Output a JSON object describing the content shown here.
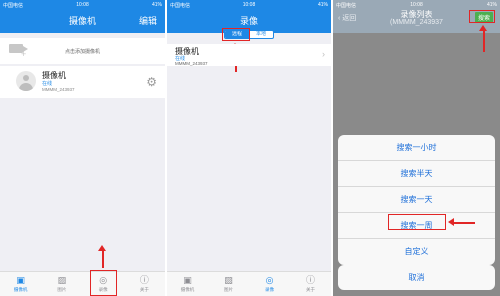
{
  "status": {
    "carrier": "中国电信",
    "time": "10:08",
    "battery": "41%"
  },
  "screen1": {
    "title": "摄像机",
    "edit_label": "编辑",
    "add_camera_text": "点击添加摄像机",
    "camera": {
      "name": "摄像机",
      "status": "在线",
      "id": "MMMM_243937"
    },
    "tabs": [
      {
        "label": "摄像机",
        "icon": "camera-tab-icon"
      },
      {
        "label": "图片",
        "icon": "picture-tab-icon"
      },
      {
        "label": "录像",
        "icon": "record-tab-icon"
      },
      {
        "label": "关于",
        "icon": "info-tab-icon"
      }
    ]
  },
  "screen2": {
    "title": "录像",
    "segments": [
      "远程",
      "本地"
    ],
    "camera": {
      "name": "摄像机",
      "status": "在线",
      "id": "MMMM_243937"
    },
    "tabs": [
      {
        "label": "摄像机",
        "icon": "camera-tab-icon"
      },
      {
        "label": "图片",
        "icon": "picture-tab-icon"
      },
      {
        "label": "录像",
        "icon": "record-tab-icon"
      },
      {
        "label": "关于",
        "icon": "info-tab-icon"
      }
    ]
  },
  "screen3": {
    "back_label": "返回",
    "title": "录像列表",
    "subtitle": "(MMMM_243937",
    "search_label": "搜索",
    "options": [
      "搜索一小时",
      "搜索半天",
      "搜索一天",
      "搜索一周",
      "自定义"
    ],
    "cancel_label": "取消"
  },
  "colors": {
    "accent": "#1e88e5",
    "highlight": "#e12626",
    "search_button": "#4caf50"
  }
}
